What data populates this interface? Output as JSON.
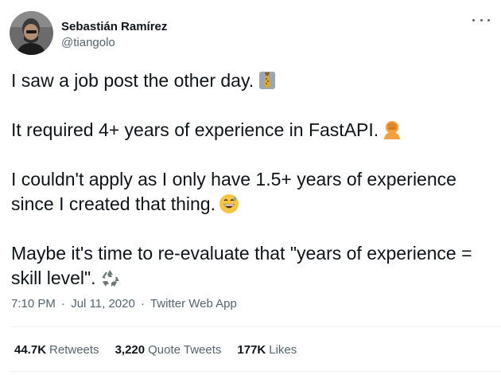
{
  "author": {
    "display_name": "Sebastián Ramírez",
    "handle": "@tiangolo",
    "avatar_icon": "avatar-photo"
  },
  "menu": {
    "icon": "more-horizontal-icon"
  },
  "tweet": {
    "paragraphs": [
      {
        "text": "I saw a job post the other day.",
        "emoji": "necktie-icon"
      },
      {
        "text": "It required 4+ years of experience in FastAPI.",
        "emoji": "facepalm-icon"
      },
      {
        "text": "I couldn't apply as I only have 1.5+ years of experience since I created that thing.",
        "emoji": "grinning-sweat-icon"
      },
      {
        "text": "Maybe it's time to re-evaluate that \"years of experience = skill level\".",
        "emoji": "recycle-icon"
      }
    ]
  },
  "meta": {
    "time": "7:10 PM",
    "separator": "·",
    "date": "Jul 11, 2020",
    "source": "Twitter Web App"
  },
  "stats": {
    "retweets": {
      "value": "44.7K",
      "label": "Retweets"
    },
    "quote_tweets": {
      "value": "3,220",
      "label": "Quote Tweets"
    },
    "likes": {
      "value": "177K",
      "label": "Likes"
    }
  },
  "colors": {
    "text_primary": "#0f1419",
    "text_secondary": "#536471",
    "divider": "#eff3f4"
  }
}
